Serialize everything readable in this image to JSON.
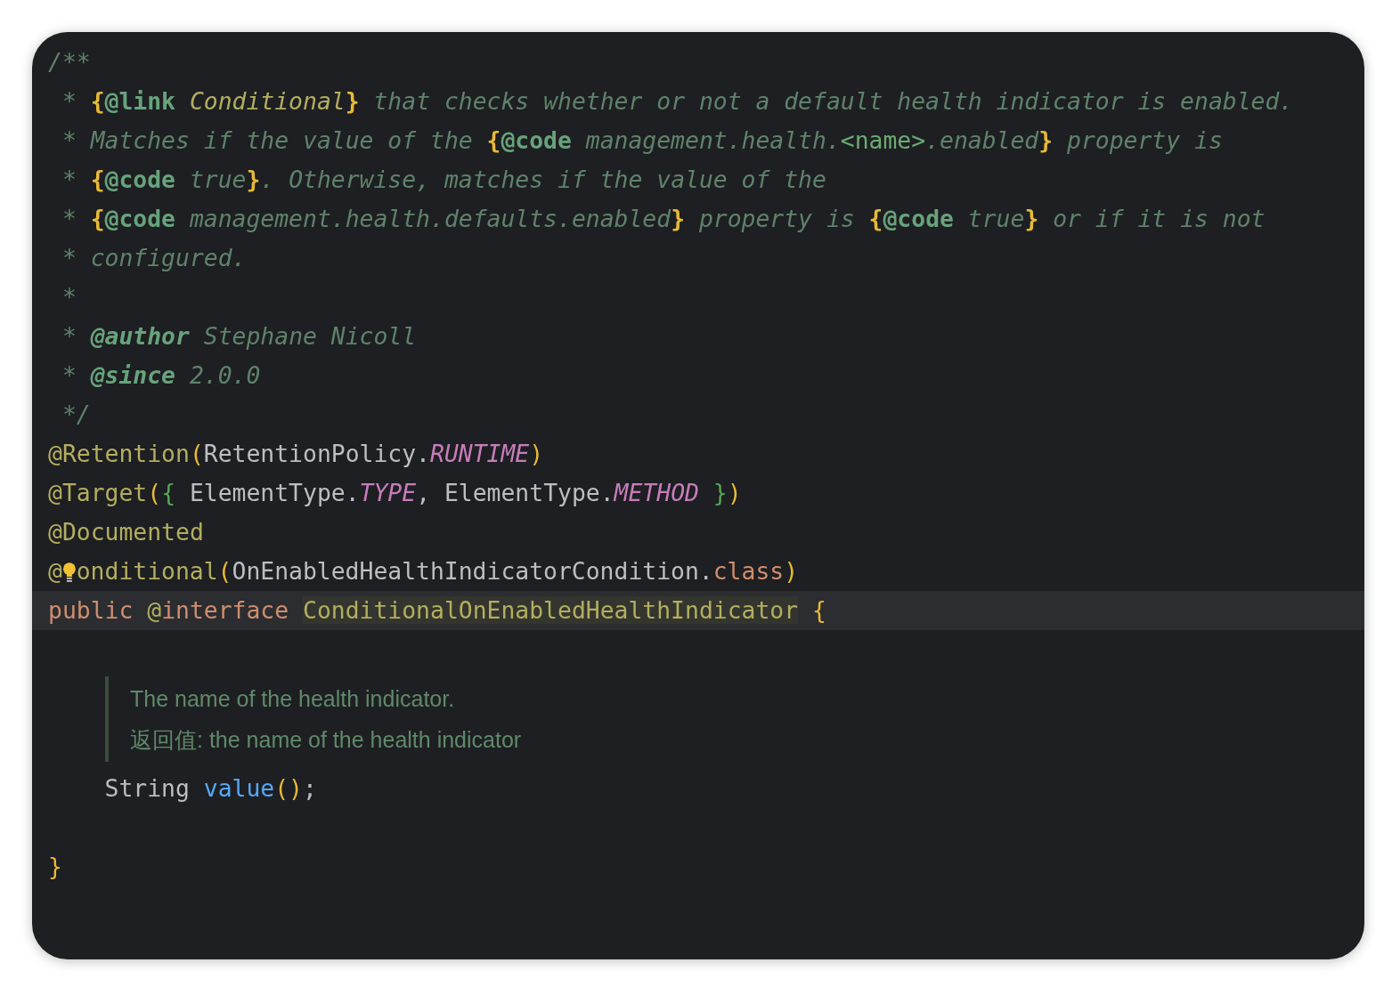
{
  "editor": {
    "lines": [
      {
        "kind": "code",
        "current": false,
        "tokens": [
          {
            "kind": "comment",
            "text": "/**"
          }
        ]
      },
      {
        "kind": "code",
        "current": false,
        "tokens": [
          {
            "kind": "comment",
            "text": " * "
          },
          {
            "kind": "brace",
            "text": "{"
          },
          {
            "kind": "doctag",
            "text": "@link"
          },
          {
            "kind": "linkref",
            "text": " Conditional"
          },
          {
            "kind": "brace",
            "text": "}"
          },
          {
            "kind": "comment",
            "text": " that checks whether or not a default health indicator is enabled."
          }
        ]
      },
      {
        "kind": "code",
        "current": false,
        "tokens": [
          {
            "kind": "comment",
            "text": " * Matches if the value of the "
          },
          {
            "kind": "brace",
            "text": "{"
          },
          {
            "kind": "doctag",
            "text": "@code"
          },
          {
            "kind": "comment",
            "text": " management.health."
          },
          {
            "kind": "markup",
            "text": "<name>"
          },
          {
            "kind": "comment",
            "text": ".enabled"
          },
          {
            "kind": "brace",
            "text": "}"
          },
          {
            "kind": "comment",
            "text": " property is"
          }
        ]
      },
      {
        "kind": "code",
        "current": false,
        "tokens": [
          {
            "kind": "comment",
            "text": " * "
          },
          {
            "kind": "brace",
            "text": "{"
          },
          {
            "kind": "doctag",
            "text": "@code"
          },
          {
            "kind": "comment",
            "text": " true"
          },
          {
            "kind": "brace",
            "text": "}"
          },
          {
            "kind": "comment",
            "text": ". Otherwise, matches if the value of the"
          }
        ]
      },
      {
        "kind": "code",
        "current": false,
        "tokens": [
          {
            "kind": "comment",
            "text": " * "
          },
          {
            "kind": "brace",
            "text": "{"
          },
          {
            "kind": "doctag",
            "text": "@code"
          },
          {
            "kind": "comment",
            "text": " management.health.defaults.enabled"
          },
          {
            "kind": "brace",
            "text": "}"
          },
          {
            "kind": "comment",
            "text": " property is "
          },
          {
            "kind": "brace",
            "text": "{"
          },
          {
            "kind": "doctag",
            "text": "@code"
          },
          {
            "kind": "comment",
            "text": " true"
          },
          {
            "kind": "brace",
            "text": "}"
          },
          {
            "kind": "comment",
            "text": " or if it is not"
          }
        ]
      },
      {
        "kind": "code",
        "current": false,
        "tokens": [
          {
            "kind": "comment",
            "text": " * configured."
          }
        ]
      },
      {
        "kind": "code",
        "current": false,
        "tokens": [
          {
            "kind": "comment",
            "text": " *"
          }
        ]
      },
      {
        "kind": "code",
        "current": false,
        "tokens": [
          {
            "kind": "comment",
            "text": " * "
          },
          {
            "kind": "javadoc",
            "text": "@author"
          },
          {
            "kind": "comment",
            "text": " Stephane Nicoll"
          }
        ]
      },
      {
        "kind": "code",
        "current": false,
        "tokens": [
          {
            "kind": "comment",
            "text": " * "
          },
          {
            "kind": "javadoc",
            "text": "@since"
          },
          {
            "kind": "comment",
            "text": " 2.0.0"
          }
        ]
      },
      {
        "kind": "code",
        "current": false,
        "tokens": [
          {
            "kind": "comment",
            "text": " */"
          }
        ]
      },
      {
        "kind": "code",
        "current": false,
        "tokens": [
          {
            "kind": "annotation",
            "text": "@Retention"
          },
          {
            "kind": "paren",
            "text": "("
          },
          {
            "kind": "plain",
            "text": "RetentionPolicy."
          },
          {
            "kind": "constant",
            "text": "RUNTIME"
          },
          {
            "kind": "paren",
            "text": ")"
          }
        ]
      },
      {
        "kind": "code",
        "current": false,
        "tokens": [
          {
            "kind": "annotation",
            "text": "@Target"
          },
          {
            "kind": "paren",
            "text": "("
          },
          {
            "kind": "inner",
            "text": "{"
          },
          {
            "kind": "plain",
            "text": " ElementType."
          },
          {
            "kind": "constant",
            "text": "TYPE"
          },
          {
            "kind": "plain",
            "text": ", ElementType."
          },
          {
            "kind": "constant",
            "text": "METHOD"
          },
          {
            "kind": "inner",
            "text": " }"
          },
          {
            "kind": "paren",
            "text": ")"
          }
        ]
      },
      {
        "kind": "code",
        "current": false,
        "tokens": [
          {
            "kind": "annotation",
            "text": "@Documented"
          }
        ]
      },
      {
        "kind": "code",
        "current": false,
        "tokens": [
          {
            "kind": "annotation",
            "text": "@"
          },
          {
            "kind": "bulb"
          },
          {
            "kind": "annotation",
            "text": "onditional"
          },
          {
            "kind": "paren",
            "text": "("
          },
          {
            "kind": "plain",
            "text": "OnEnabledHealthIndicatorCondition."
          },
          {
            "kind": "keyword",
            "text": "class"
          },
          {
            "kind": "paren",
            "text": ")"
          }
        ]
      },
      {
        "kind": "code",
        "current": true,
        "tokens": [
          {
            "kind": "keyword",
            "text": "public "
          },
          {
            "kind": "annotation",
            "text": "@"
          },
          {
            "kind": "keyword",
            "text": "interface "
          },
          {
            "kind": "highlight",
            "text": "ConditionalOnEnabledHealthIndicator"
          },
          {
            "kind": "paren",
            "text": " {"
          }
        ]
      },
      {
        "kind": "doc",
        "texts": [
          "The name of the health indicator.",
          "返回值: the name of the health indicator"
        ]
      },
      {
        "kind": "code",
        "current": false,
        "tokens": [
          {
            "kind": "plain",
            "text": "    String "
          },
          {
            "kind": "method",
            "text": "value"
          },
          {
            "kind": "paren",
            "text": "()"
          },
          {
            "kind": "plain",
            "text": ";"
          }
        ]
      },
      {
        "kind": "blank"
      },
      {
        "kind": "code",
        "current": false,
        "tokens": [
          {
            "kind": "paren",
            "text": "}"
          }
        ]
      }
    ]
  }
}
